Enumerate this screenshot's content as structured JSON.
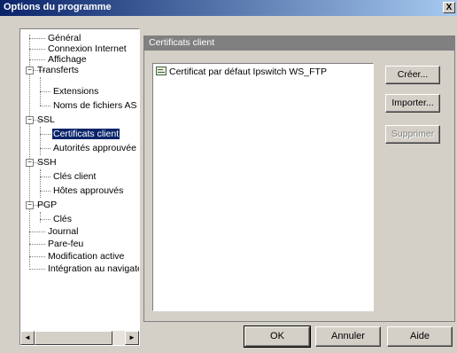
{
  "window": {
    "title": "Options du programme",
    "close_glyph": "X"
  },
  "tree": {
    "items": [
      {
        "label": "Général"
      },
      {
        "label": "Connexion Internet"
      },
      {
        "label": "Affichage"
      },
      {
        "label": "Transferts",
        "expander": "−"
      },
      {
        "label": "Extensions"
      },
      {
        "label": "Noms de fichiers AS"
      },
      {
        "label": "SSL",
        "expander": "−"
      },
      {
        "label": "Certificats client",
        "selected": true
      },
      {
        "label": "Autorités approuvée"
      },
      {
        "label": "SSH",
        "expander": "−"
      },
      {
        "label": "Clés client"
      },
      {
        "label": "Hôtes approuvés"
      },
      {
        "label": "PGP",
        "expander": "−"
      },
      {
        "label": "Clés"
      },
      {
        "label": "Journal"
      },
      {
        "label": "Pare-feu"
      },
      {
        "label": "Modification active"
      },
      {
        "label": "Intégration au navigateu"
      }
    ],
    "scroll_left_glyph": "◄",
    "scroll_right_glyph": "►"
  },
  "panel": {
    "header": "Certificats client",
    "certificates": [
      "Certificat par défaut Ipswitch WS_FTP"
    ],
    "buttons": {
      "create": "Créer...",
      "import": "Importer...",
      "delete": "Supprimer"
    }
  },
  "footer": {
    "ok": "OK",
    "cancel": "Annuler",
    "help": "Aide"
  }
}
